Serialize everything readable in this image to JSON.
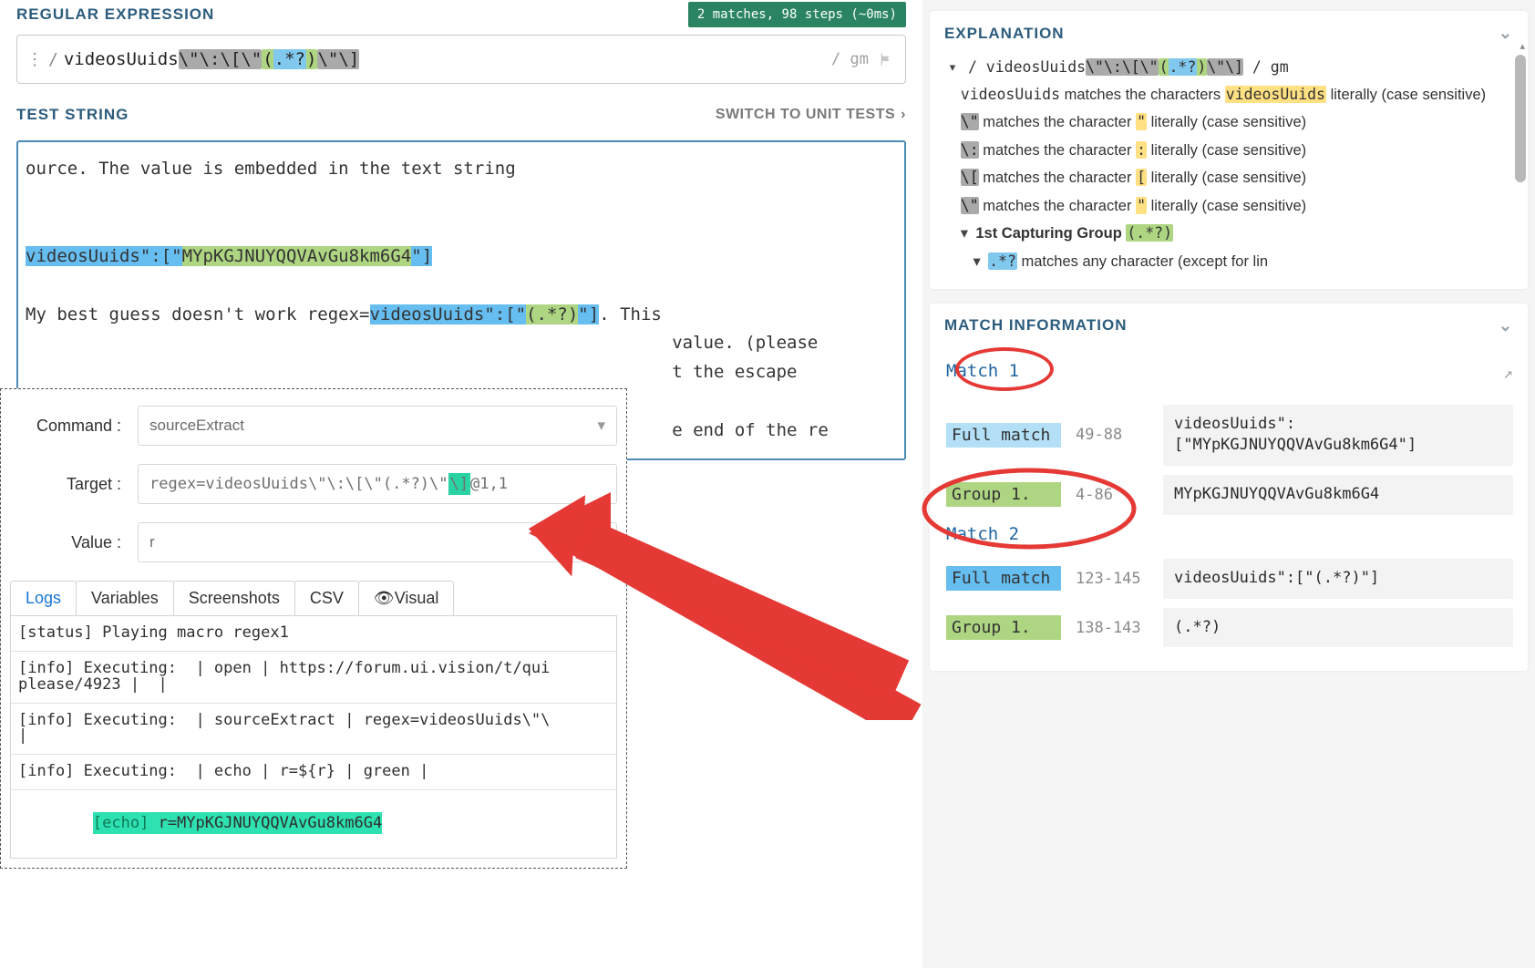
{
  "left": {
    "regex_header": "REGULAR EXPRESSION",
    "badge": "2 matches, 98 steps (~0ms)",
    "regex_prefix_slash": "/",
    "regex_literal": "videosUuids",
    "regex_escaped": "\\\"\\:\\[\\\"",
    "regex_group_open": "(",
    "regex_group_body": ".*?",
    "regex_group_close": ")",
    "regex_escaped_tail": "\\\"\\]",
    "flags_label": "/ gm",
    "test_header": "TEST STRING",
    "switch_link": "SWITCH TO UNIT TESTS",
    "test_line1": "ource. The value is embedded in the text string",
    "test_m1_prefix": "videosUuids\":[\"",
    "test_m1_group": "MYpKGJNUYQQVAvGu8km6G4",
    "test_m1_suffix": "\"]",
    "test_line3_pre": "My best guess doesn't work regex=",
    "test_m2_prefix": "videosUuids\":[\"",
    "test_m2_group": "(.*?)",
    "test_m2_suffix": "\"]",
    "test_line3_post": ". This ",
    "test_line4": "                                                              value. (please",
    "test_line5": "                                                              t the escape",
    "test_line6": "                                                              e end of the re"
  },
  "overlay": {
    "cmd_label": "Command :",
    "cmd_value": "sourceExtract",
    "target_label": "Target :",
    "target_pre": "regex=videosUuids\\\"\\:\\[\\\"(.*?)\\\"",
    "target_hl": "\\]",
    "target_post": "@1,1",
    "value_label": "Value :",
    "value_value": "r",
    "tabs": {
      "logs": "Logs",
      "vars": "Variables",
      "shots": "Screenshots",
      "csv": "CSV",
      "visual": "👁Visual"
    },
    "logs": {
      "l0": "[status] Playing macro regex1",
      "l1": "[info] Executing:  | open | https://forum.ui.vision/t/qui\nplease/4923 |  |",
      "l2": "[info] Executing:  | sourceExtract | regex=videosUuids\\\"\\\n|",
      "l3": "[info] Executing:  | echo | r=${r} | green |",
      "l4_a": "[echo]",
      "l4_b": "r=MYpKGJNUYQQVAvGu8km6G4"
    }
  },
  "explanation": {
    "header": "EXPLANATION",
    "line_regex_slash": "/ videosUuids",
    "line_regex_esc": "\\\"\\:\\[\\\"",
    "line_regex_group": "(.*?)",
    "line_regex_tail": "\\\"\\]",
    "line_regex_flags": " / gm",
    "line_lit_a": "videosUuids",
    "line_lit_b": " matches the characters ",
    "line_lit_c": "videosUuids",
    "line_lit_d": " literally (case sensitive)",
    "esc_quote": "\\\"",
    "esc_quote_txt_a": " matches the character ",
    "esc_quote_txt_b": "\"",
    "esc_quote_txt_c": " literally (case sensitive)",
    "esc_colon": "\\:",
    "esc_colon_txt_b": ":",
    "esc_lbr": "\\[",
    "esc_lbr_txt_b": "[",
    "group_header": "1st Capturing Group ",
    "group_hl": "(.*?)",
    "group_body_hl": ".*?",
    "group_body_txt": " matches any character (except for lin"
  },
  "match": {
    "header": "MATCH INFORMATION",
    "m1": "Match 1",
    "full": "Full match",
    "m1_full_pos": "49-88",
    "m1_full_code": "videosUuids\":[\"MYpKGJNUYQQVAvGu8km6G4\"]",
    "group1": "Group 1.",
    "m1_g1_pos": "4-86",
    "m1_g1_code": "MYpKGJNUYQQVAvGu8km6G4",
    "m2": "Match 2",
    "m2_full_pos": "123-145",
    "m2_full_code": "videosUuids\":[\"(.*?)\"]",
    "m2_g1_pos": "138-143",
    "m2_g1_code": "(.*?)"
  }
}
